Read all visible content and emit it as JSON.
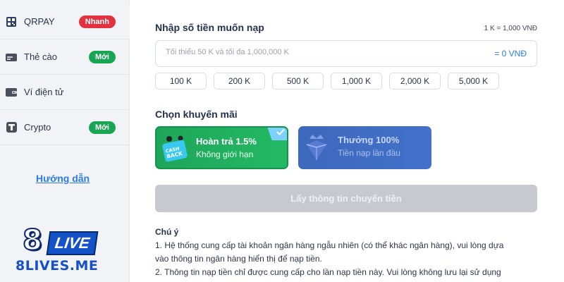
{
  "sidebar": {
    "items": [
      {
        "label": "QRPAY",
        "badge": "Nhanh",
        "badge_color": "#e3323f",
        "icon": "qr-code-icon"
      },
      {
        "label": "Thẻ cào",
        "badge": "Mới",
        "badge_color": "#18a655",
        "icon": "card-icon"
      },
      {
        "label": "Ví điện tử",
        "badge": "",
        "icon": "wallet-icon"
      },
      {
        "label": "Crypto",
        "badge": "Mới",
        "badge_color": "#18a655",
        "icon": "tether-icon"
      }
    ],
    "guide_link": "Hướng dẫn",
    "logo": {
      "mark": "8",
      "live": "LIVE",
      "domain": "8LIVES.ME"
    }
  },
  "deposit": {
    "title": "Nhập số tiền muốn nạp",
    "rate": "1 K = 1,000 VNĐ",
    "placeholder": "Tối thiểu 50 K và tối đa 1,000,000 K",
    "converted": "= 0 VNĐ",
    "chips": [
      "100 K",
      "200 K",
      "500 K",
      "1,000 K",
      "2,000 K",
      "5,000 K"
    ]
  },
  "promotions": {
    "title": "Chọn khuyến mãi",
    "options": [
      {
        "title": "Hoàn trả 1.5%",
        "subtitle": "Không giới hạn",
        "art_text": "CASH BACK",
        "selected": true
      },
      {
        "title": "Thưởng 100%",
        "subtitle": "Tiền nạp lần đầu",
        "selected": false
      }
    ]
  },
  "submit_label": "Lấy thông tin chuyển tiền",
  "notes": {
    "title": "Chú ý",
    "lines": [
      "1. Hệ thống cung cấp tài khoản ngân hàng ngẫu nhiên (có thể khác ngân hàng), vui lòng dựa",
      "vào thông tin ngân hàng hiển thị để nạp tiền.",
      "2. Thông tin nạp tiền chỉ được cung cấp cho lần nạp tiền này. Vui lòng không lưu lại sử dụng"
    ]
  },
  "colors": {
    "accent": "#2c7be5",
    "promo_green": "#1fa55a",
    "promo_blue": "#1b4fb0",
    "submit_disabled": "#c6c9cf"
  }
}
